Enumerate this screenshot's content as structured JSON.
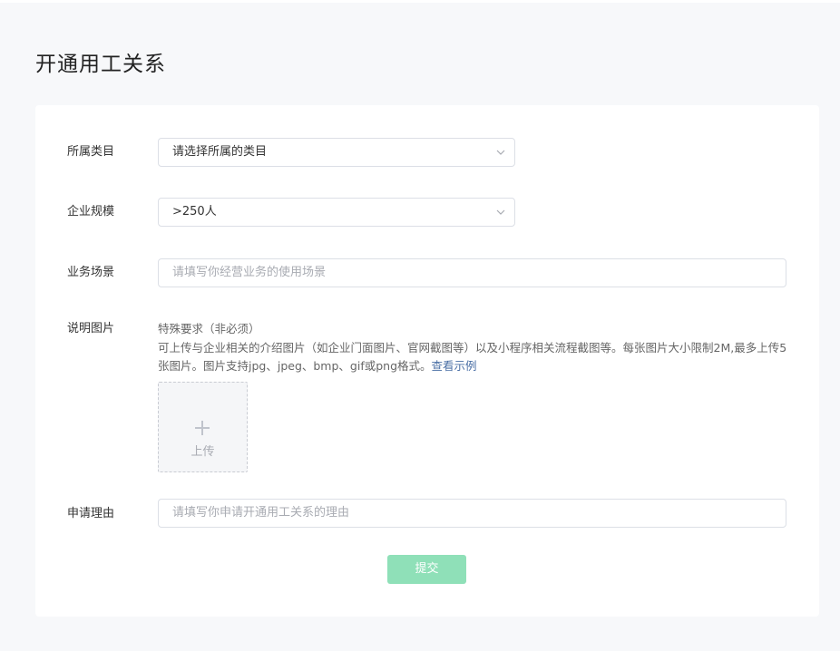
{
  "page": {
    "title": "开通用工关系"
  },
  "form": {
    "category": {
      "label": "所属类目",
      "value": "请选择所属的类目",
      "icon": "chevron-down-icon"
    },
    "scale": {
      "label": "企业规模",
      "value": ">250人",
      "icon": "chevron-down-icon"
    },
    "scenario": {
      "label": "业务场景",
      "placeholder": "请填写你经营业务的使用场景"
    },
    "images": {
      "label": "说明图片",
      "hint_title": "特殊要求（非必须）",
      "hint_text": "可上传与企业相关的介绍图片（如企业门面图片、官网截图等）以及小程序相关流程截图等。每张图片大小限制2M,最多上传5张图片。图片支持jpg、jpeg、bmp、gif或png格式。",
      "example_link": "查看示例",
      "upload_label": "上传",
      "upload_icon": "plus-icon"
    },
    "reason": {
      "label": "申请理由",
      "placeholder": "请填写你申请开通用工关系的理由"
    },
    "submit_label": "提交"
  },
  "colors": {
    "background": "#f7f8fa",
    "card": "#ffffff",
    "submit": "#8fe0b8",
    "link": "#4a6fa5",
    "border": "#dcdfe6"
  }
}
